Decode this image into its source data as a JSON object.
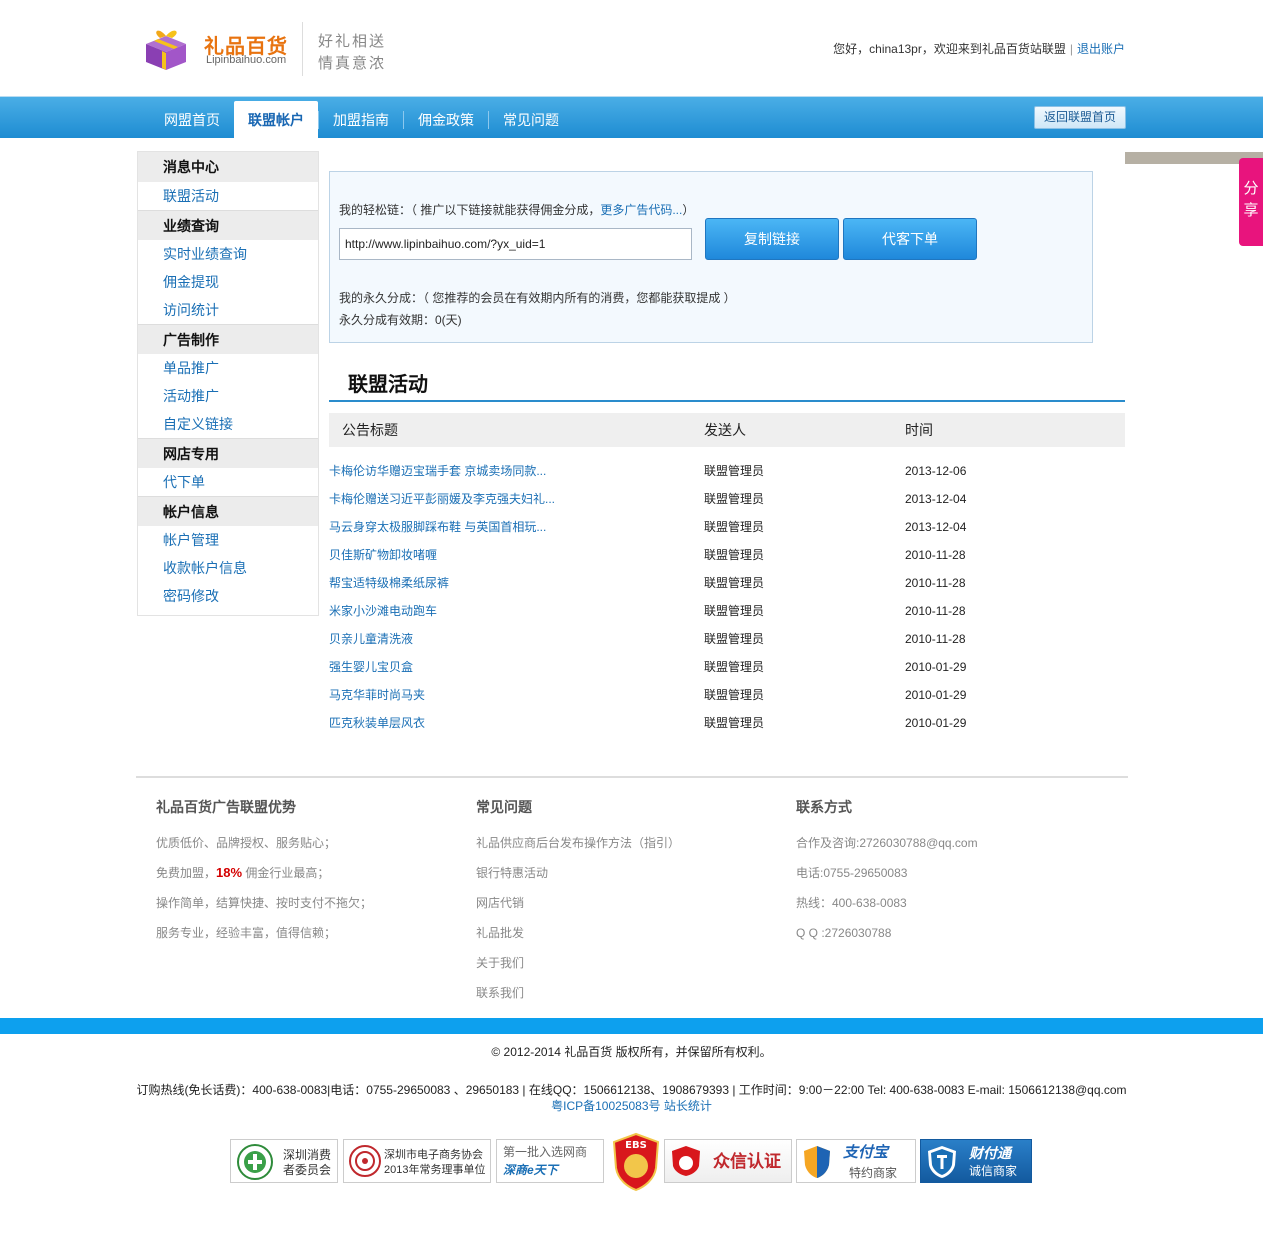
{
  "header": {
    "brand_name": "礼品百货",
    "brand_domain": "Lipinbaihuo.com",
    "slogan_line1": "好礼相送",
    "slogan_line2": "情真意浓",
    "welcome_text": "您好，china13pr，欢迎来到礼品百货站联盟",
    "separator": "|",
    "logout_label": "退出账户"
  },
  "nav": {
    "items": [
      {
        "label": "网盟首页"
      },
      {
        "label": "联盟帐户"
      },
      {
        "label": "加盟指南"
      },
      {
        "label": "佣金政策"
      },
      {
        "label": "常见问题"
      }
    ],
    "active_index": 1,
    "back_button": "返回联盟首页"
  },
  "sidebar": {
    "groups": [
      {
        "title": "消息中心",
        "items": [
          "联盟活动"
        ]
      },
      {
        "title": "业绩查询",
        "items": [
          "实时业绩查询",
          "佣金提现",
          "访问统计"
        ]
      },
      {
        "title": "广告制作",
        "items": [
          "单品推广",
          "活动推广",
          "自定义链接"
        ]
      },
      {
        "title": "网店专用",
        "items": [
          "代下单"
        ]
      },
      {
        "title": "帐户信息",
        "items": [
          "帐户管理",
          "收款帐户信息",
          "密码修改"
        ]
      }
    ]
  },
  "linkbox": {
    "label_prefix": "我的轻松链：（ 推广以下链接就能获得佣金分成，",
    "more_link": "更多广告代码...",
    "label_suffix": "）",
    "url_value": "http://www.lipinbaihuo.com/?yx_uid=1",
    "copy_button": "复制链接",
    "order_button": "代客下单",
    "permanent_text": "我的永久分成：（ 您推荐的会员在有效期内所有的消费，您都能获取提成 ）",
    "validity_text": "永久分成有效期：0(天)"
  },
  "activity": {
    "title": "联盟活动",
    "columns": [
      "公告标题",
      "发送人",
      "时间"
    ],
    "rows": [
      {
        "title": "卡梅伦访华赠迈宝瑞手套 京城卖场同款...",
        "sender": "联盟管理员",
        "date": "2013-12-06"
      },
      {
        "title": "卡梅伦赠送习近平彭丽媛及李克强夫妇礼...",
        "sender": "联盟管理员",
        "date": "2013-12-04"
      },
      {
        "title": "马云身穿太极服脚踩布鞋 与英国首相玩...",
        "sender": "联盟管理员",
        "date": "2013-12-04"
      },
      {
        "title": "贝佳斯矿物卸妆啫喱",
        "sender": "联盟管理员",
        "date": "2010-11-28"
      },
      {
        "title": "帮宝适特级棉柔纸尿裤",
        "sender": "联盟管理员",
        "date": "2010-11-28"
      },
      {
        "title": "米家小沙滩电动跑车",
        "sender": "联盟管理员",
        "date": "2010-11-28"
      },
      {
        "title": "贝亲儿童清洗液",
        "sender": "联盟管理员",
        "date": "2010-11-28"
      },
      {
        "title": "强生婴儿宝贝盒",
        "sender": "联盟管理员",
        "date": "2010-01-29"
      },
      {
        "title": "马克华菲时尚马夹",
        "sender": "联盟管理员",
        "date": "2010-01-29"
      },
      {
        "title": "匹克秋装单层风衣",
        "sender": "联盟管理员",
        "date": "2010-01-29"
      }
    ]
  },
  "share_tab": {
    "line1": "分",
    "line2": "享"
  },
  "footer": {
    "col1": {
      "title": "礼品百货广告联盟优势",
      "line1": "优质低价、品牌授权、服务贴心；",
      "line2_prefix": "免费加盟，",
      "line2_highlight": "18%",
      "line2_suffix": " 佣金行业最高；",
      "line3": "操作简单，结算快捷、按时支付不拖欠；",
      "line4": "服务专业，经验丰富，值得信赖；"
    },
    "col2": {
      "title": "常见问题",
      "items": [
        "礼品供应商后台发布操作方法（指引）",
        "银行特惠活动",
        "网店代销",
        "礼品批发",
        "关于我们",
        "联系我们"
      ]
    },
    "col3": {
      "title": "联系方式",
      "items": [
        "合作及咨询:2726030788@qq.com",
        "电话:0755-29650083",
        "热线：400-638-0083",
        "Q Q :2726030788"
      ]
    },
    "copyright": "© 2012-2014 礼品百货 版权所有，并保留所有权利。",
    "hotline": "订购热线(免长话费)：400-638-0083|电话：0755-29650083 、29650183 | 在线QQ：1506612138、1908679393 | 工作时间：9:00－22:00 Tel: 400-638-0083 E-mail: 1506612138@qq.com",
    "icp": "粤ICP备10025083号 站长统计"
  },
  "badges": {
    "b1_line1": "深圳消费",
    "b1_line2": "者委员会",
    "b2_line1": "深圳市电子商务协会",
    "b2_line2": "2013年常务理事单位",
    "b3_line1": "第一批入选网商",
    "b3_line2": "深商e天下",
    "b4_label": "EBS",
    "b5_label": "众信认证",
    "b6_line1": "支付宝",
    "b6_line2": "特约商家",
    "b7_line1": "财付通",
    "b7_line2": "诚信商家"
  },
  "colors": {
    "nav_blue": "#1e8cd2",
    "link_blue": "#1a6fb5",
    "brand_orange": "#e8730f",
    "share_pink": "#e8147d",
    "footer_band": "#0da0ee"
  }
}
